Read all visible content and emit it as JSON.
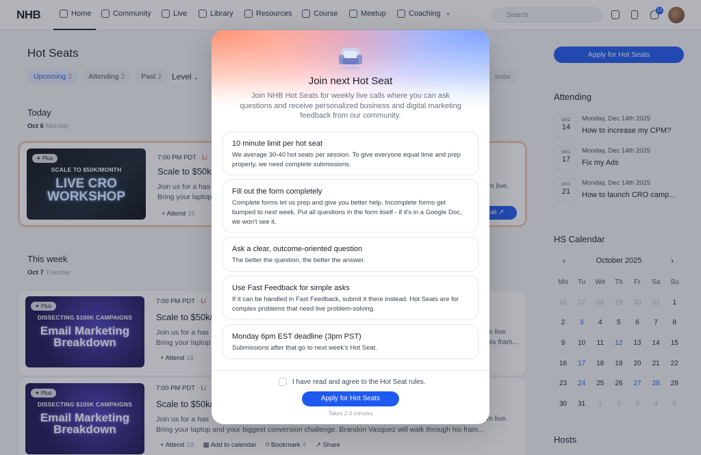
{
  "nav": {
    "logo": "NHB",
    "items": [
      {
        "label": "Home",
        "icon": "home-icon"
      },
      {
        "label": "Community",
        "icon": "chat-icon"
      },
      {
        "label": "Live",
        "icon": "calendar-icon"
      },
      {
        "label": "Library",
        "icon": "library-icon"
      },
      {
        "label": "Resources",
        "icon": "resources-icon"
      },
      {
        "label": "Course",
        "icon": "course-icon"
      },
      {
        "label": "Meetup",
        "icon": "meetup-icon"
      },
      {
        "label": "Coaching",
        "icon": "coaching-icon"
      }
    ],
    "search_placeholder": "Search",
    "notification_count": "12"
  },
  "page": {
    "title": "Hot Seats",
    "tabs": [
      {
        "label": "Upcoming",
        "count": "2"
      },
      {
        "label": "Attending",
        "count": "2"
      },
      {
        "label": "Past",
        "count": "2"
      }
    ],
    "level_label": "Level",
    "calendar_chip": "endar"
  },
  "sections": {
    "today": {
      "title": "Today",
      "date": "Oct 6",
      "weekday": "Monday"
    },
    "this_week": {
      "title": "This week",
      "date": "Oct 7",
      "weekday": "Tuesday"
    }
  },
  "cards": [
    {
      "tag": "Plus",
      "thumb_kicker": "SCALE TO $50K/MONTH",
      "thumb_big": "LIVE CRO\nWORKSHOP",
      "time": "7:00 PM PDT",
      "live": " · Li",
      "title": "Scale to $50k/",
      "desc": "Join us for a has",
      "desc2": "Bring your laptop",
      "attend": "Attend",
      "attend_count": "18",
      "join": "call",
      "right_text": "m live.",
      "right_text2": "his fram..."
    },
    {
      "tag": "Plus",
      "thumb_kicker": "DISSECTING $100K CAMPAIGNS",
      "thumb_big": "Email Marketing\nBreakdown",
      "time": "7:00 PM PDT",
      "live": " · Li",
      "title": "Scale to $50k/",
      "desc": "Join us for a has",
      "desc2": "Bring your laptop",
      "attend": "Attend",
      "attend_count": "18",
      "right_text": "m live.",
      "right_text2": "his fram..."
    },
    {
      "tag": "Plus",
      "thumb_kicker": "DISSECTING $100K CAMPAIGNS",
      "thumb_big": "Email Marketing\nBreakdown",
      "time": "7:00 PM PDT",
      "live": " · Li",
      "title": "Scale to $50k/",
      "desc": "Join us for a has",
      "desc2": "Bring your laptop and your biggest conversion challenge. Brandon Vasquez will walk through his fram...",
      "attend": "Attend",
      "attend_count": "18",
      "add_calendar": "Add to calendar",
      "bookmark": "Bookmark",
      "bookmark_count": "4",
      "share": "Share",
      "right_text": "m live."
    }
  ],
  "sidebar": {
    "apply_label": "Apply for Hot Seats",
    "attending_title": "Attending",
    "attending": [
      {
        "month": "DEC",
        "day": "14",
        "when": "Monday, Dec 14th 2025",
        "title": "How to increase my CPM?"
      },
      {
        "month": "DEC",
        "day": "17",
        "when": "Monday, Dec 14th 2025",
        "title": "Fix my Ads"
      },
      {
        "month": "DEC",
        "day": "21",
        "when": "Monday, Dec 14th 2025",
        "title": "How to launch CRO camp..."
      }
    ],
    "calendar_title": "HS Calendar",
    "calendar_month": "October 2025",
    "calendar_days": [
      "Mo",
      "Tu",
      "We",
      "Th",
      "Fr",
      "Sa",
      "Su"
    ],
    "calendar_cells": [
      {
        "d": "26",
        "s": "out"
      },
      {
        "d": "27",
        "s": "out"
      },
      {
        "d": "28",
        "s": "out"
      },
      {
        "d": "29",
        "s": "out"
      },
      {
        "d": "30",
        "s": "out"
      },
      {
        "d": "31",
        "s": "out"
      },
      {
        "d": "1",
        "s": ""
      },
      {
        "d": "2",
        "s": ""
      },
      {
        "d": "3",
        "s": "ev"
      },
      {
        "d": "4",
        "s": ""
      },
      {
        "d": "5",
        "s": ""
      },
      {
        "d": "6",
        "s": ""
      },
      {
        "d": "7",
        "s": ""
      },
      {
        "d": "8",
        "s": ""
      },
      {
        "d": "9",
        "s": ""
      },
      {
        "d": "10",
        "s": ""
      },
      {
        "d": "11",
        "s": ""
      },
      {
        "d": "12",
        "s": "ev"
      },
      {
        "d": "13",
        "s": ""
      },
      {
        "d": "14",
        "s": ""
      },
      {
        "d": "15",
        "s": ""
      },
      {
        "d": "16",
        "s": ""
      },
      {
        "d": "17",
        "s": "ev"
      },
      {
        "d": "18",
        "s": ""
      },
      {
        "d": "19",
        "s": ""
      },
      {
        "d": "20",
        "s": ""
      },
      {
        "d": "21",
        "s": ""
      },
      {
        "d": "22",
        "s": ""
      },
      {
        "d": "23",
        "s": ""
      },
      {
        "d": "24",
        "s": "ev"
      },
      {
        "d": "25",
        "s": ""
      },
      {
        "d": "26",
        "s": ""
      },
      {
        "d": "27",
        "s": "ev"
      },
      {
        "d": "28",
        "s": "ev"
      },
      {
        "d": "29",
        "s": ""
      },
      {
        "d": "30",
        "s": ""
      },
      {
        "d": "31",
        "s": ""
      },
      {
        "d": "1",
        "s": "out"
      },
      {
        "d": "2",
        "s": "out"
      },
      {
        "d": "3",
        "s": "out"
      },
      {
        "d": "4",
        "s": "out"
      },
      {
        "d": "5",
        "s": "out"
      }
    ],
    "hosts_title": "Hosts"
  },
  "modal": {
    "title": "Join next Hot Seat",
    "subtitle": "Join NHB Hot Seats for weekly live calls where you can ask questions and receive personalized business and digital marketing feedback from our community.",
    "rules": [
      {
        "title": "10 minute limit per hot seat",
        "body": "We average 30-40 hot seats per session. To give everyone equal time and prep properly, we need complete submissions."
      },
      {
        "title": "Fill out the form completely",
        "body": "Complete forms let us prep and give you better help. Incomplete forms get bumped to next week. Put all questions in the form itself - if it's in a Google Doc, we won't see it."
      },
      {
        "title": "Ask a clear, outcome-oriented question",
        "body": "The better the question, the better the answer."
      },
      {
        "title": "Use Fast Feedback for simple asks",
        "body": "If it can be handled in Fast Feedback, submit it there instead. Hot Seats are for complex problems that need live problem-solving."
      },
      {
        "title": "Monday 6pm EST deadline (3pm PST)",
        "body": "Submissions after that go to next week's Hot Seat."
      }
    ],
    "agree_label": "I have read and agree to the Hot Seat rules.",
    "apply_label": "Apply for Hot Seats",
    "takes": "Takes 2-3 minutes"
  },
  "colors": {
    "accent": "#1f5af0",
    "live": "#d93838",
    "highlight_border": "#f2c6b6"
  }
}
